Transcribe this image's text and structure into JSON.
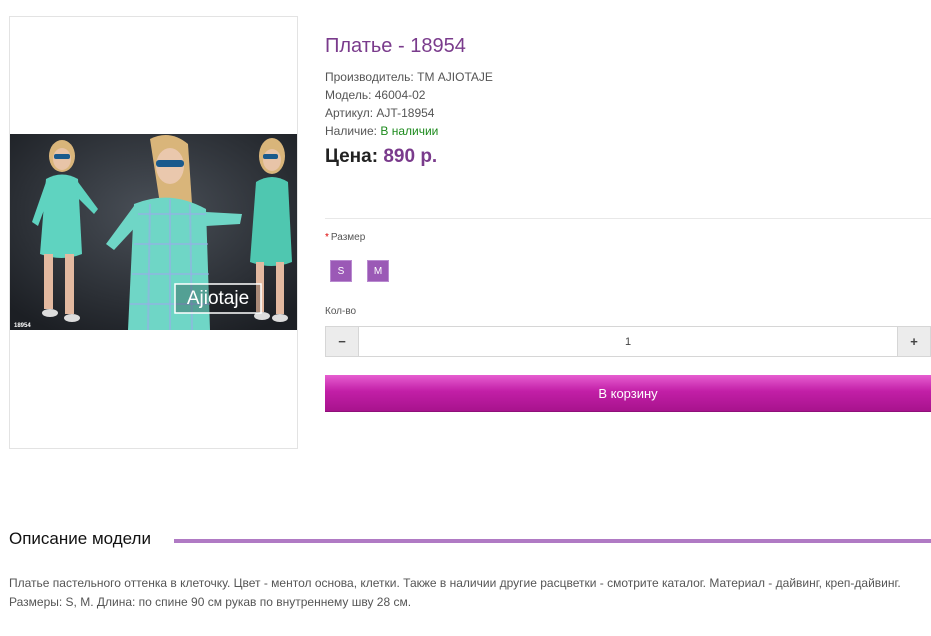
{
  "product": {
    "title": "Платье - 18954",
    "manufacturer_label": "Производитель:",
    "manufacturer": "ТМ AJIOTAJE",
    "model_label": "Модель:",
    "model": "46004-02",
    "sku_label": "Артикул:",
    "sku": "AJT-18954",
    "availability_label": "Наличие:",
    "availability": "В наличии",
    "price_label": "Цена:",
    "price": "890 р.",
    "image": {
      "brand_text": "Ajiotaje",
      "code_text": "18954"
    }
  },
  "options": {
    "required_mark": "*",
    "size_label": "Размер",
    "sizes": [
      "S",
      "M"
    ]
  },
  "quantity": {
    "label": "Кол-во",
    "value": "1",
    "minus": "−",
    "plus": "+"
  },
  "cart_button": "В корзину",
  "description": {
    "heading": "Описание модели",
    "text": "Платье пастельного оттенка в клеточку. Цвет - ментол основа, клетки. Также в наличии другие расцветки - смотрите каталог. Материал - дайвинг, креп-дайвинг. Размеры: S, M. Длина: по спине 90 см рукав по внутреннему шву 28 см."
  },
  "colors": {
    "accent_purple": "#7a3b8c",
    "size_button": "#9b59b6",
    "cart_gradient_top": "#e65ed0",
    "cart_gradient_bottom": "#a8138d",
    "in_stock_green": "#1c8a1c"
  }
}
